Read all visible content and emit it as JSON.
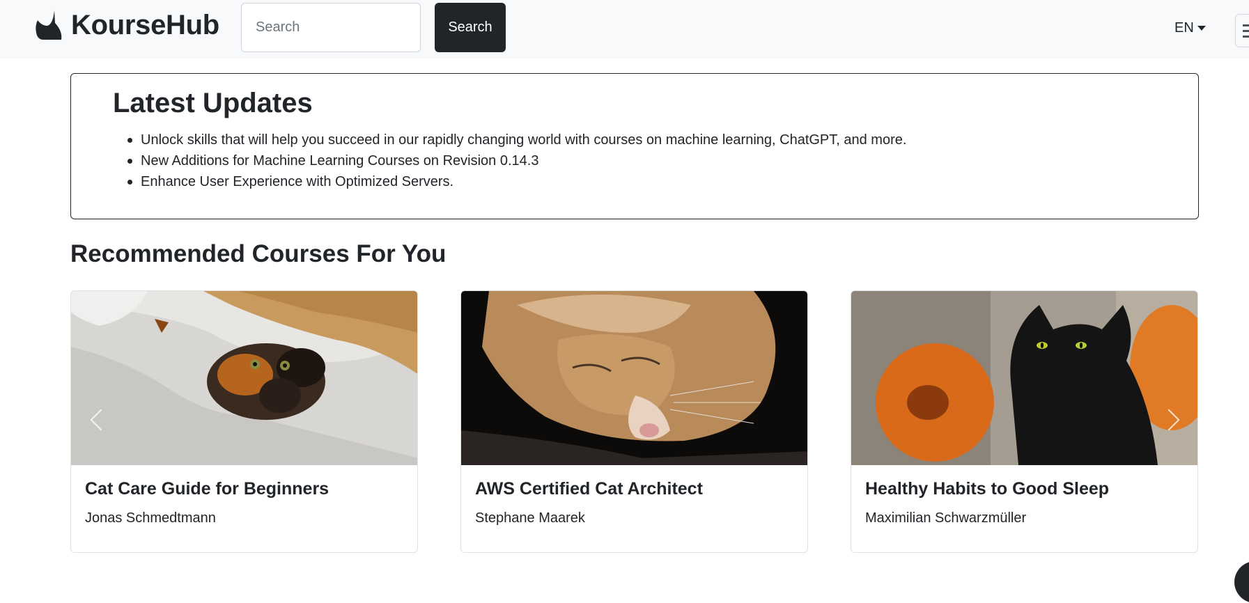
{
  "navbar": {
    "brand": "KourseHub",
    "search_placeholder": "Search",
    "search_button": "Search",
    "language": "EN"
  },
  "updates": {
    "title": "Latest Updates",
    "items": [
      "Unlock skills that will help you succeed in our rapidly changing world with courses on machine learning, ChatGPT, and more.",
      "New Additions for Machine Learning Courses on Revision 0.14.3",
      "Enhance User Experience with Optimized Servers."
    ]
  },
  "recommended": {
    "title": "Recommended Courses For You",
    "courses": [
      {
        "title": "Cat Care Guide for Beginners",
        "author": "Jonas Schmedtmann",
        "image": "calico-cat-photo"
      },
      {
        "title": "AWS Certified Cat Architect",
        "author": "Stephane Maarek",
        "image": "orange-tabby-sleeping-photo"
      },
      {
        "title": "Healthy Habits to Good Sleep",
        "author": "Maximilian Schwarzmüller",
        "image": "black-cat-pumpkins-photo"
      }
    ]
  },
  "colors": {
    "navbar_bg": "#f8f9fa",
    "dark": "#212529",
    "border": "#dee2e6"
  }
}
